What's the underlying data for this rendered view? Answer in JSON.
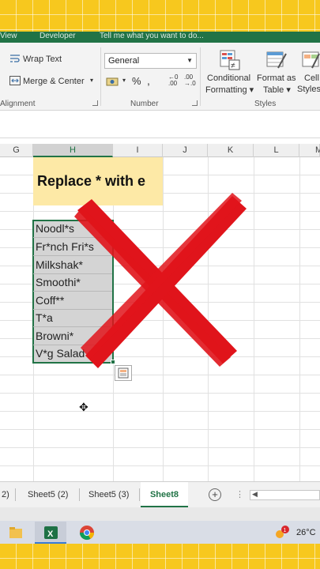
{
  "ribbon": {
    "tabs": [
      "View",
      "Developer",
      "Tell me what you want to do..."
    ],
    "alignment": {
      "wrap_text": "Wrap Text",
      "merge_center": "Merge & Center",
      "group_label": "Alignment"
    },
    "number": {
      "format": "General",
      "percent": "%",
      "group_label": "Number"
    },
    "styles": {
      "conditional_formatting_line1": "Conditional",
      "conditional_formatting_line2": "Formatting",
      "format_as_table_line1": "Format as",
      "format_as_table_line2": "Table",
      "cell_styles_line1": "Cell",
      "cell_styles_line2": "Styles",
      "group_label": "Styles"
    }
  },
  "grid": {
    "columns": [
      "G",
      "H",
      "I",
      "J",
      "K",
      "L",
      "M"
    ],
    "selected_column": "H",
    "title": "Replace * with e",
    "cells": [
      "Noodl*s",
      "Fr*nch Fri*s",
      "Milkshak*",
      "Smoothi*",
      "Coff**",
      "T*a",
      "Browni*",
      "V*g Salad"
    ]
  },
  "sheets": {
    "tabs": [
      "2)",
      "Sheet5 (2)",
      "Sheet5 (3)",
      "Sheet8"
    ],
    "active": "Sheet8",
    "add_label": "+"
  },
  "taskbar": {
    "weather": "26°C",
    "notification_count": "1",
    "apps": [
      "file-explorer",
      "excel",
      "chrome"
    ]
  },
  "overlay": {
    "mark": "red-x-icon",
    "color": "#e0141b"
  },
  "colors": {
    "excel_green": "#217346",
    "title_fill": "#fde9a6",
    "frame_yellow": "#f7c81e"
  }
}
